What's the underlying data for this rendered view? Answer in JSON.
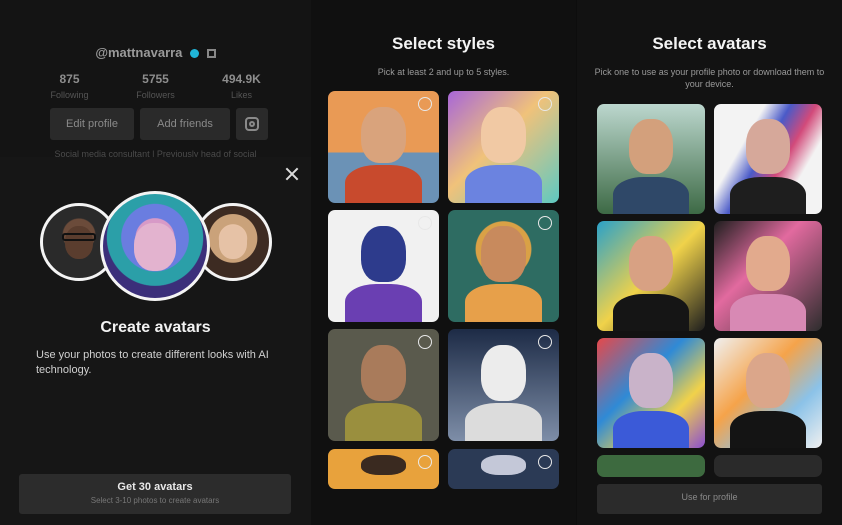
{
  "profile": {
    "handle": "@mattnavarra",
    "stats": [
      {
        "value": "875",
        "label": "Following"
      },
      {
        "value": "5755",
        "label": "Followers"
      },
      {
        "value": "494.9K",
        "label": "Likes"
      }
    ],
    "edit_profile": "Edit profile",
    "add_friends": "Add friends",
    "bio": "Social media consultant | Previously head of social"
  },
  "create_sheet": {
    "title": "Create avatars",
    "description": "Use your photos to create different looks with AI technology.",
    "cta_label": "Get 30 avatars",
    "cta_sub": "Select 3-10 photos to create avatars"
  },
  "styles_panel": {
    "title": "Select styles",
    "subtitle": "Pick at least 2 and up to 5 styles."
  },
  "avatars_panel": {
    "title": "Select avatars",
    "subtitle": "Pick one to use as your profile photo or download them to your device.",
    "use_button": "Use for profile"
  },
  "icons": [
    "verified-badge-icon",
    "qr-code-icon",
    "instagram-icon",
    "close-icon",
    "select-circle-icon"
  ],
  "colors": {
    "background": "#121212",
    "accent_verified": "#20b5d8",
    "button": "#2c2c2c"
  }
}
